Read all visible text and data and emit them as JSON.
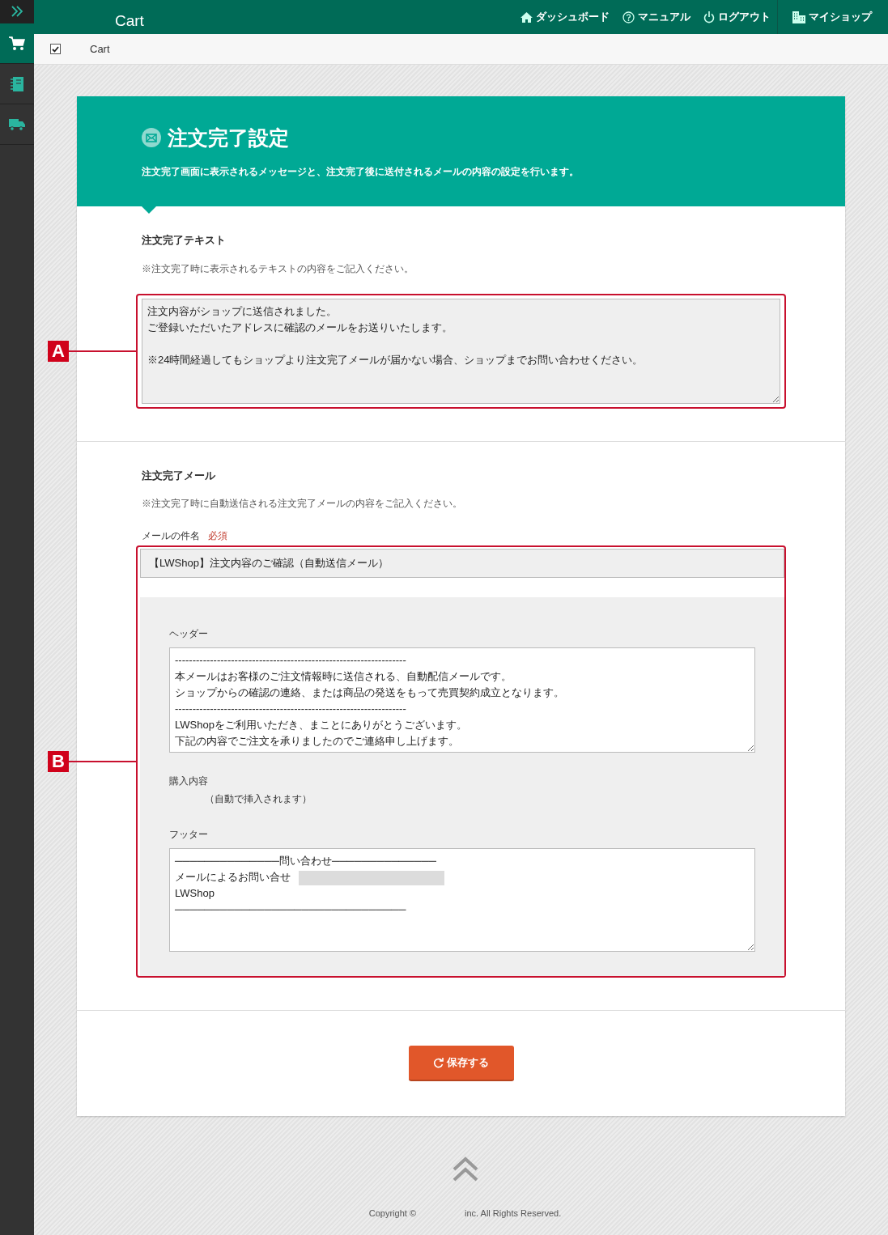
{
  "sidebar": {
    "items": [
      {
        "kind": "expand",
        "selected": false
      },
      {
        "kind": "cart",
        "selected": true
      },
      {
        "kind": "book",
        "selected": false
      },
      {
        "kind": "truck",
        "selected": false
      }
    ]
  },
  "topbar": {
    "title": "Cart",
    "links": [
      {
        "kind": "home",
        "label": "ダッシュボード"
      },
      {
        "kind": "help",
        "label": "マニュアル"
      },
      {
        "kind": "power",
        "label": "ログアウト"
      },
      {
        "kind": "shop",
        "label": "マイショップ"
      }
    ]
  },
  "breadcrumb": {
    "checked": true,
    "label": "Cart"
  },
  "panel": {
    "title": "注文完了設定",
    "description": "注文完了画面に表示されるメッセージと、注文完了後に送付されるメールの内容の設定を行います。",
    "completion_text": {
      "heading": "注文完了テキスト",
      "note": "※注文完了時に表示されるテキストの内容をご記入ください。",
      "annotation": "A",
      "paragraphs": [
        [
          "注文内容がショップに送信されました。",
          "ご登録いただいたアドレスに確認のメールをお送りいたします。"
        ],
        [
          "※24時間経過してもショップより注文完了メールが届かない場合、ショップまでお問い合わせください。"
        ]
      ]
    },
    "completion_mail": {
      "heading": "注文完了メール",
      "note": "※注文完了時に自動送信される注文完了メールの内容をご記入ください。",
      "annotation": "B",
      "subject_label": "メールの件名",
      "required": "必須",
      "subject": "【LWShop】注文内容のご確認（自動送信メール）",
      "header_label": "ヘッダー",
      "header": [
        "------------------------------------------------------------------",
        "本メールはお客様のご注文情報時に送信される、自動配信メールです。",
        "ショップからの確認の連絡、または商品の発送をもって売買契約成立となります。",
        "------------------------------------------------------------------",
        "LWShopをご利用いただき、まことにありがとうございます。",
        "下記の内容でご注文を承りましたのでご連絡申し上げます。"
      ],
      "content_label": "購入内容",
      "content_note": "（自動で挿入されます）",
      "footer_label": "フッター",
      "footer": [
        "──────────────問い合わせ──────────────",
        "メールによるお問い合せ",
        "LWShop",
        "───────────────────────────────"
      ]
    },
    "save_button": "保存する"
  },
  "footer": {
    "copyright": "Copyright ©",
    "rights": "inc. All Rights Reserved."
  }
}
